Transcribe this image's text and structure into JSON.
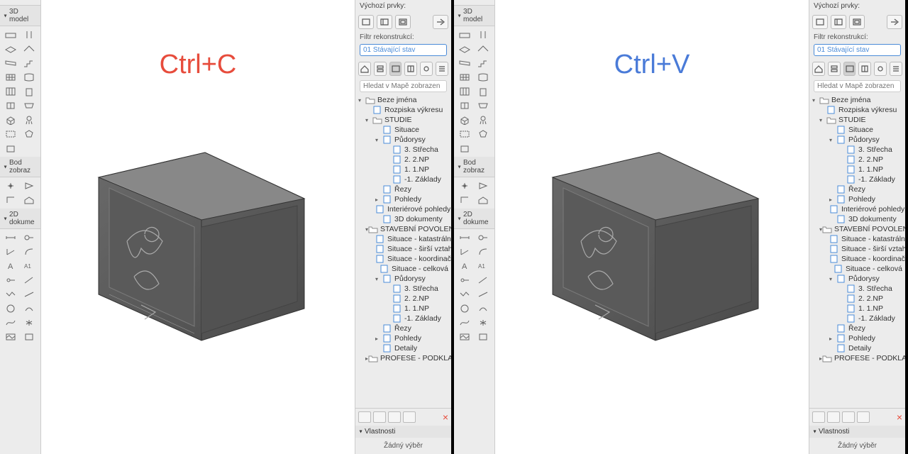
{
  "left": {
    "overlay": "Ctrl+C",
    "tbTop": "Výchozí prvky:",
    "section3d": "3D model",
    "sectionBZ": "Bod zobraz",
    "section2D": "2D dokume",
    "filterLabel": "Filtr rekonstrukcí:",
    "filterValue": "01 Stávající stav",
    "searchPlaceholder": "Hledat v Mapě zobrazen",
    "tree": [
      {
        "lvl": 0,
        "exp": "▾",
        "ico": "folder",
        "label": "Beze jména"
      },
      {
        "lvl": 1,
        "exp": "",
        "ico": "page",
        "label": "Rozpiska výkresu"
      },
      {
        "lvl": 1,
        "exp": "▾",
        "ico": "folder",
        "label": "STUDIE"
      },
      {
        "lvl": 2,
        "exp": "",
        "ico": "page",
        "label": "Situace"
      },
      {
        "lvl": 2,
        "exp": "▾",
        "ico": "page",
        "label": "Půdorysy"
      },
      {
        "lvl": 3,
        "exp": "",
        "ico": "page",
        "label": "3. Střecha"
      },
      {
        "lvl": 3,
        "exp": "",
        "ico": "page",
        "label": "2. 2.NP"
      },
      {
        "lvl": 3,
        "exp": "",
        "ico": "page",
        "label": "1. 1.NP"
      },
      {
        "lvl": 3,
        "exp": "",
        "ico": "page",
        "label": "-1. Základy"
      },
      {
        "lvl": 2,
        "exp": "",
        "ico": "page",
        "label": "Řezy"
      },
      {
        "lvl": 2,
        "exp": "▸",
        "ico": "page",
        "label": "Pohledy"
      },
      {
        "lvl": 2,
        "exp": "",
        "ico": "page",
        "label": "Interiérové pohledy"
      },
      {
        "lvl": 2,
        "exp": "",
        "ico": "page",
        "label": "3D dokumenty"
      },
      {
        "lvl": 1,
        "exp": "▾",
        "ico": "folder",
        "label": "STAVEBNÍ POVOLENÍ"
      },
      {
        "lvl": 2,
        "exp": "",
        "ico": "page",
        "label": "Situace - katastráln"
      },
      {
        "lvl": 2,
        "exp": "",
        "ico": "page",
        "label": "Situace - širší vztah"
      },
      {
        "lvl": 2,
        "exp": "",
        "ico": "page",
        "label": "Situace - koordinač"
      },
      {
        "lvl": 2,
        "exp": "",
        "ico": "page",
        "label": "Situace -  celková"
      },
      {
        "lvl": 2,
        "exp": "▾",
        "ico": "page",
        "label": "Půdorysy"
      },
      {
        "lvl": 3,
        "exp": "",
        "ico": "page",
        "label": "3. Střecha"
      },
      {
        "lvl": 3,
        "exp": "",
        "ico": "page",
        "label": "2. 2.NP"
      },
      {
        "lvl": 3,
        "exp": "",
        "ico": "page",
        "label": "1. 1.NP"
      },
      {
        "lvl": 3,
        "exp": "",
        "ico": "page",
        "label": "-1. Základy"
      },
      {
        "lvl": 2,
        "exp": "",
        "ico": "page",
        "label": "Řezy"
      },
      {
        "lvl": 2,
        "exp": "▸",
        "ico": "page",
        "label": "Pohledy"
      },
      {
        "lvl": 2,
        "exp": "",
        "ico": "page",
        "label": "Detaily"
      },
      {
        "lvl": 1,
        "exp": "▸",
        "ico": "folder",
        "label": "PROFESE - PODKLAD"
      }
    ],
    "propsTitle": "Vlastnosti",
    "propsSel": "Žádný výběr"
  },
  "right": {
    "overlay": "Ctrl+V",
    "tbTop": "Výchozí prvky:",
    "section3d": "3D model",
    "sectionBZ": "Bod zobraz",
    "section2D": "2D dokume",
    "filterLabel": "Filtr rekonstrukcí:",
    "filterValue": "01 Stávající stav",
    "searchPlaceholder": "Hledat v Mapě zobrazen",
    "propsTitle": "Vlastnosti",
    "propsSel": "Žádný výběr"
  }
}
